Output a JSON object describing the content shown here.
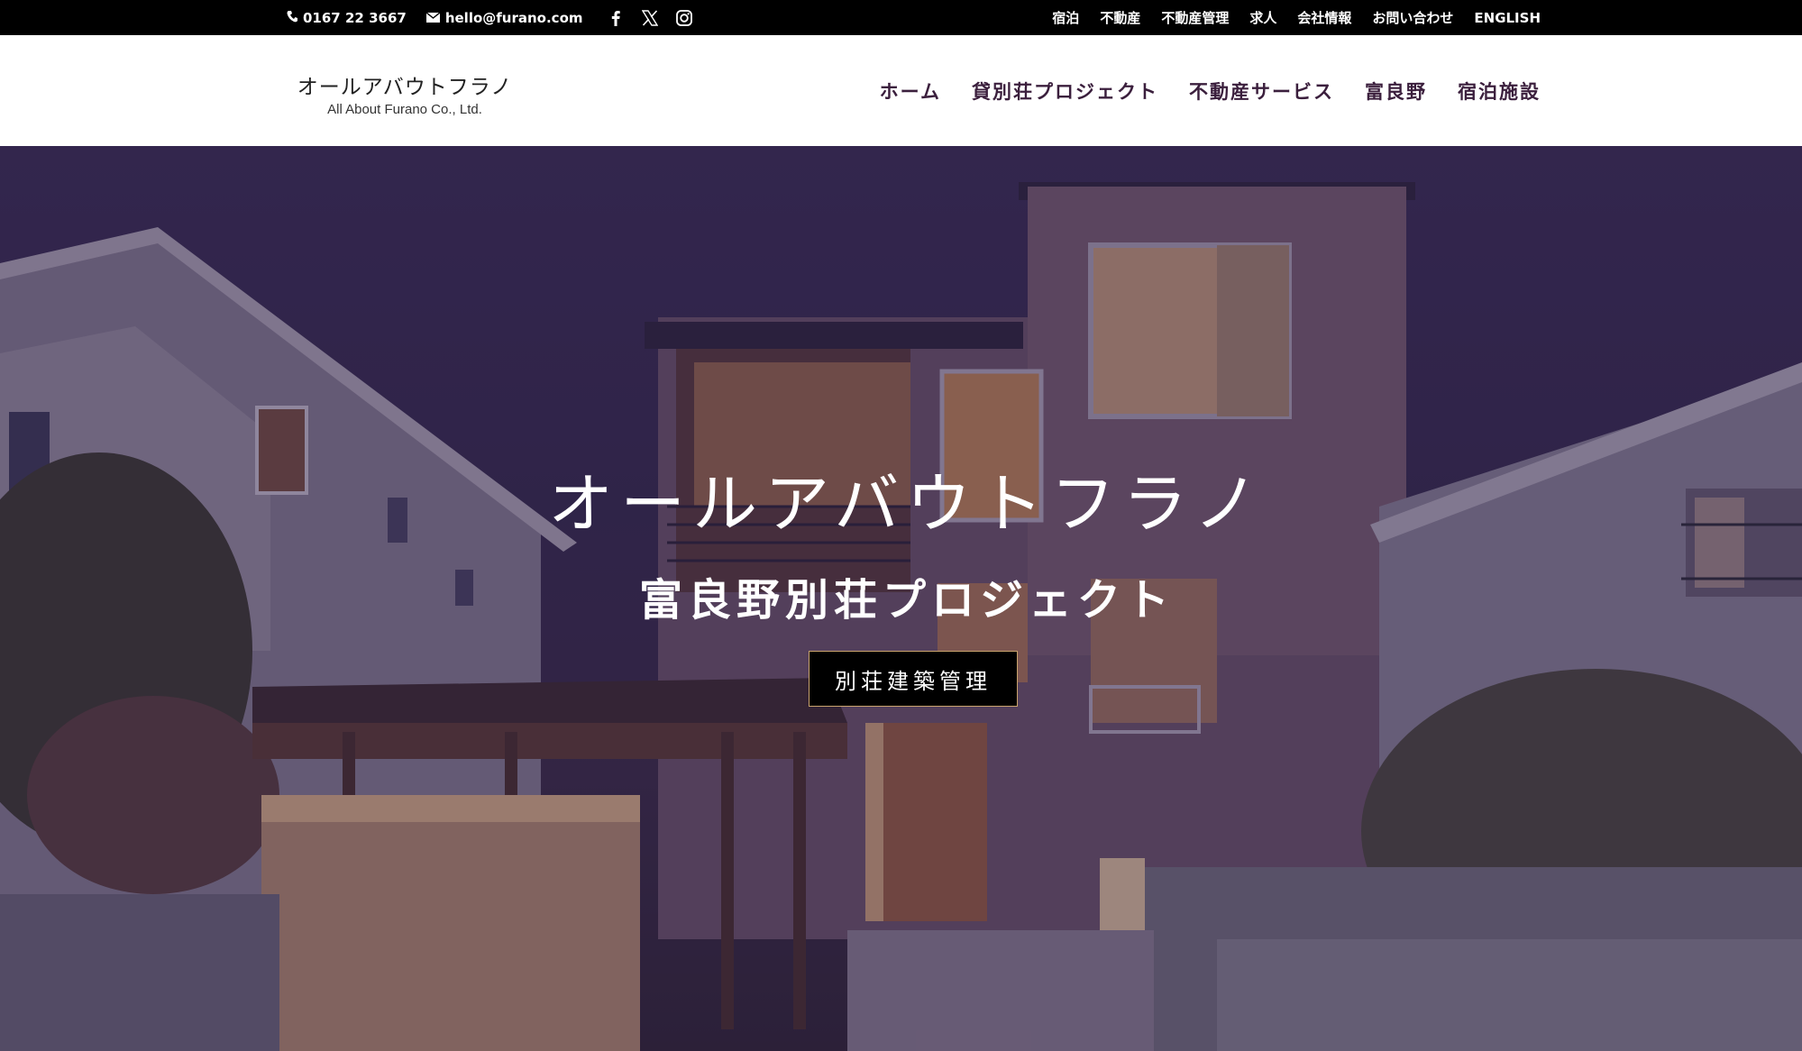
{
  "topbar": {
    "phone": "0167 22 3667",
    "email": "hello@furano.com",
    "social_icons": [
      "facebook-icon",
      "x-icon",
      "instagram-icon"
    ],
    "secondary_nav": [
      "宿泊",
      "不動産",
      "不動産管理",
      "求人",
      "会社情報",
      "お問い合わせ",
      "ENGLISH"
    ]
  },
  "header": {
    "logo_jp": "オールアバウトフラノ",
    "logo_en": "All About Furano Co., Ltd.",
    "main_nav": [
      "ホーム",
      "貸別荘プロジェクト",
      "不動産サービス",
      "富良野",
      "宿泊施設"
    ]
  },
  "hero": {
    "title": "オールアバウトフラノ",
    "subtitle": "富良野別荘プロジェクト",
    "button_label": "別荘建築管理"
  },
  "colors": {
    "topbar_bg": "#000000",
    "nav_text": "#3b1f3d",
    "hero_overlay": "#281946",
    "button_border": "#c9a36d"
  }
}
